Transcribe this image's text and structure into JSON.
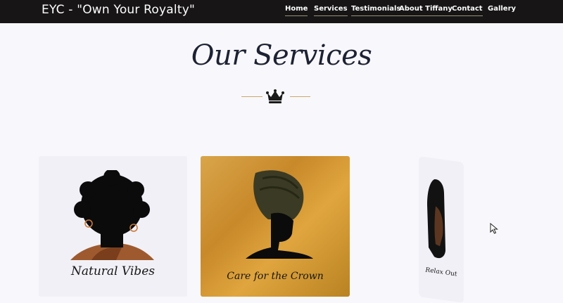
{
  "brand": "EYC - \"Own Your Royalty\"",
  "nav": {
    "items": [
      {
        "label": "Home"
      },
      {
        "label": "Services"
      },
      {
        "label": "Testimonials"
      },
      {
        "label": "About Tiffany"
      },
      {
        "label": "Contact"
      },
      {
        "label": "Gallery"
      }
    ]
  },
  "services": {
    "title": "Our Services",
    "cards": [
      {
        "caption": "Natural Vibes"
      },
      {
        "caption": "Care for the Crown"
      },
      {
        "caption": "Relax Out"
      }
    ]
  },
  "colors": {
    "navbar": "#171515",
    "accent_gold": "#c9a86a",
    "title": "#1d2233"
  },
  "icons": [
    "crown-icon",
    "mouse-cursor-icon"
  ]
}
